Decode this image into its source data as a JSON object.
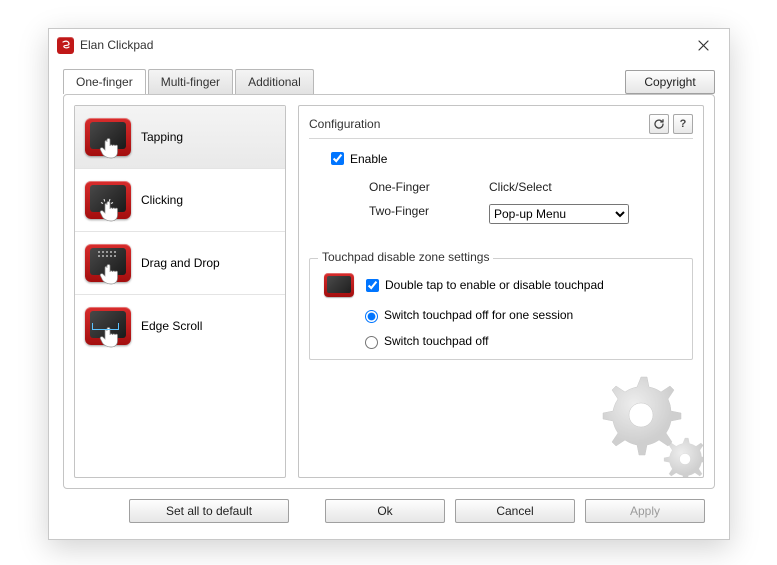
{
  "title": "Elan Clickpad",
  "tabs": [
    "One-finger",
    "Multi-finger",
    "Additional"
  ],
  "active_tab": 0,
  "copyright_label": "Copyright",
  "sidebar": {
    "items": [
      "Tapping",
      "Clicking",
      "Drag and Drop",
      "Edge Scroll"
    ],
    "selected": 0
  },
  "config": {
    "title": "Configuration",
    "enable_label": "Enable",
    "enable_checked": true,
    "rows": {
      "one_finger_label": "One-Finger",
      "one_finger_value": "Click/Select",
      "two_finger_label": "Two-Finger",
      "two_finger_value": "Pop-up Menu"
    },
    "disable_zone": {
      "legend": "Touchpad disable zone settings",
      "doubletap_label": "Double tap to enable or disable touchpad",
      "doubletap_checked": true,
      "radios": [
        {
          "label": "Switch touchpad off for one session",
          "checked": true
        },
        {
          "label": "Switch touchpad off",
          "checked": false
        }
      ]
    }
  },
  "actions": {
    "set_default": "Set all to default",
    "ok": "Ok",
    "cancel": "Cancel",
    "apply": "Apply"
  }
}
